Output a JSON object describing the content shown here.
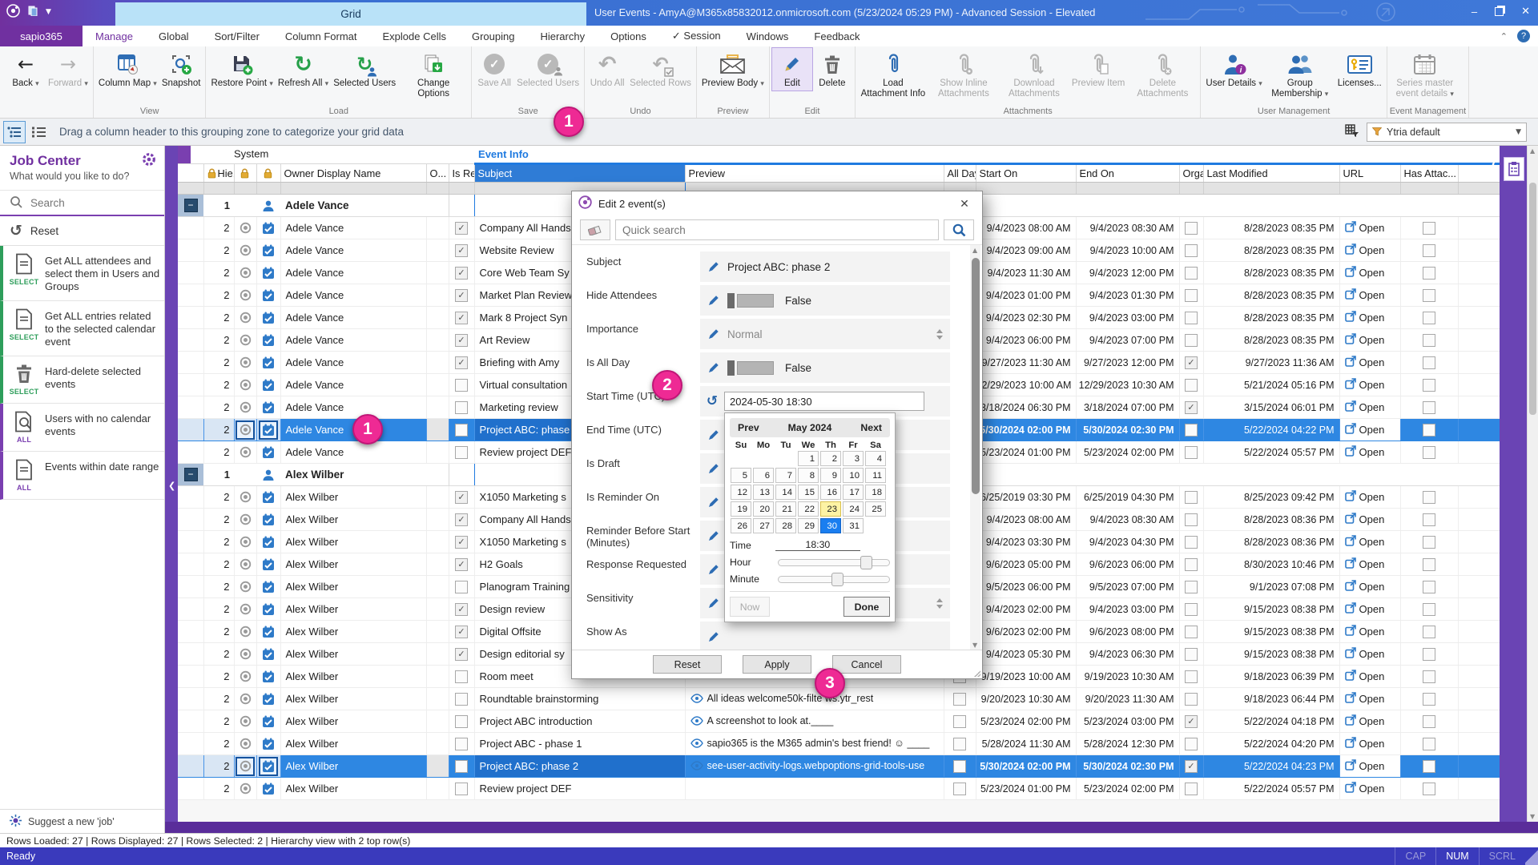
{
  "titlebar": {
    "tab": "Grid",
    "title": "User Events - AmyA@M365x85832012.onmicrosoft.com (5/23/2024 05:29 PM) - Advanced Session - Elevated"
  },
  "tabs": {
    "app": "sapio365",
    "active": "Manage",
    "items": [
      "Manage",
      "Global",
      "Sort/Filter",
      "Column Format",
      "Explode Cells",
      "Grouping",
      "Hierarchy",
      "Options",
      "✓ Session",
      "Windows",
      "Feedback"
    ]
  },
  "ribbon": {
    "groups": [
      {
        "label": "",
        "items": [
          {
            "icon": "arrow-left",
            "label": "Back",
            "enabled": true,
            "drop": true
          },
          {
            "icon": "arrow-right",
            "label": "Forward",
            "enabled": false,
            "drop": true
          }
        ]
      },
      {
        "label": "View",
        "items": [
          {
            "icon": "column-map",
            "label": "Column Map",
            "enabled": true,
            "drop": true
          },
          {
            "icon": "snapshot",
            "label": "Snapshot",
            "enabled": true
          }
        ]
      },
      {
        "label": "Load",
        "items": [
          {
            "icon": "restore-point",
            "label": "Restore Point",
            "enabled": true,
            "drop": true
          },
          {
            "icon": "refresh",
            "label": "Refresh All",
            "enabled": true,
            "drop": true
          },
          {
            "icon": "refresh-users",
            "label": "Selected Users",
            "enabled": true
          },
          {
            "icon": "change-options",
            "label": "Change Options",
            "enabled": true
          }
        ]
      },
      {
        "label": "Save",
        "items": [
          {
            "icon": "save-all",
            "label": "Save All",
            "enabled": false
          },
          {
            "icon": "save-users",
            "label": "Selected Users",
            "enabled": false
          }
        ]
      },
      {
        "label": "Undo",
        "items": [
          {
            "icon": "undo",
            "label": "Undo All",
            "enabled": false
          },
          {
            "icon": "undo-rows",
            "label": "Selected Rows",
            "enabled": false
          }
        ]
      },
      {
        "label": "Preview",
        "items": [
          {
            "icon": "envelope",
            "label": "Preview Body",
            "enabled": true,
            "drop": true
          }
        ]
      },
      {
        "label": "Edit",
        "items": [
          {
            "icon": "pencil",
            "label": "Edit",
            "enabled": true,
            "highlight": true
          },
          {
            "icon": "trash",
            "label": "Delete",
            "enabled": true
          }
        ]
      },
      {
        "label": "Attachments",
        "items": [
          {
            "icon": "clip-blue",
            "label": "Load Attachment Info",
            "enabled": true
          },
          {
            "icon": "clip-eye",
            "label": "Show Inline Attachments",
            "enabled": false
          },
          {
            "icon": "clip-down",
            "label": "Download Attachments",
            "enabled": false
          },
          {
            "icon": "clip-doc",
            "label": "Preview Item",
            "enabled": false
          },
          {
            "icon": "clip-x",
            "label": "Delete Attachments",
            "enabled": false
          }
        ]
      },
      {
        "label": "User Management",
        "items": [
          {
            "icon": "user-info",
            "label": "User Details",
            "enabled": true,
            "drop": true
          },
          {
            "icon": "users",
            "label": "Group Membership",
            "enabled": true,
            "drop": true
          },
          {
            "icon": "license",
            "label": "Licenses...",
            "enabled": true
          }
        ]
      },
      {
        "label": "Event Management",
        "items": [
          {
            "icon": "calendar-gray",
            "label": "Series master event details",
            "enabled": false,
            "drop": true
          }
        ]
      }
    ]
  },
  "groupbar": {
    "hint": "Drag a column header to this grouping zone to categorize your grid data",
    "preset": "Ytria default"
  },
  "sidebar": {
    "title": "Job Center",
    "subtitle": "What would you like to do?",
    "search_placeholder": "Search",
    "reset": "Reset",
    "items": [
      {
        "badge": "SELECT",
        "accent": "#2e9e5b",
        "icon": "doc",
        "label": "Get ALL attendees and select them in Users and Groups"
      },
      {
        "badge": "SELECT",
        "accent": "#2e9e5b",
        "icon": "doc",
        "label": "Get ALL entries related to the selected calendar event"
      },
      {
        "badge": "SELECT",
        "accent": "#2e9e5b",
        "icon": "trash",
        "label": "Hard-delete selected events"
      },
      {
        "badge": "ALL",
        "accent": "#7a3fb0",
        "icon": "doc-search",
        "label": "Users with no calendar events"
      },
      {
        "badge": "ALL",
        "accent": "#7a3fb0",
        "icon": "doc",
        "label": "Events within date range"
      }
    ],
    "footer": "Suggest a new 'job'"
  },
  "grid": {
    "bands": [
      "System",
      "Event Info"
    ],
    "open_label": "Open",
    "columns": [
      {
        "key": "hie",
        "label": "Hie...",
        "lock": true
      },
      {
        "key": "icon1",
        "label": "",
        "lock": true
      },
      {
        "key": "icon2",
        "label": "",
        "lock": true
      },
      {
        "key": "owner",
        "label": "Owner Display Name"
      },
      {
        "key": "o",
        "label": "O..."
      },
      {
        "key": "isrec",
        "label": "Is Rec..."
      },
      {
        "key": "subject",
        "label": "Subject",
        "selected": true
      },
      {
        "key": "preview",
        "label": "Preview"
      },
      {
        "key": "allday",
        "label": "All Day"
      },
      {
        "key": "start",
        "label": "Start On"
      },
      {
        "key": "end",
        "label": "End On"
      },
      {
        "key": "organizer",
        "label": "Organi..."
      },
      {
        "key": "modified",
        "label": "Last Modified"
      },
      {
        "key": "url",
        "label": "URL"
      },
      {
        "key": "attach",
        "label": "Has Attac..."
      }
    ],
    "groups": [
      {
        "count": "1",
        "name": "Adele Vance",
        "rows": [
          {
            "hie": "2",
            "isrec": true,
            "subject": "Company All Hands",
            "start": "9/4/2023 08:00 AM",
            "end": "9/4/2023 08:30 AM",
            "org": false,
            "mod": "8/28/2023 08:35 PM"
          },
          {
            "hie": "2",
            "isrec": true,
            "subject": "Website Review",
            "start": "9/4/2023 09:00 AM",
            "end": "9/4/2023 10:00 AM",
            "org": false,
            "mod": "8/28/2023 08:35 PM"
          },
          {
            "hie": "2",
            "isrec": true,
            "subject": "Core Web Team Sy",
            "start": "9/4/2023 11:30 AM",
            "end": "9/4/2023 12:00 PM",
            "org": false,
            "mod": "8/28/2023 08:35 PM"
          },
          {
            "hie": "2",
            "isrec": true,
            "subject": "Market Plan Review",
            "start": "9/4/2023 01:00 PM",
            "end": "9/4/2023 01:30 PM",
            "org": false,
            "mod": "8/28/2023 08:35 PM"
          },
          {
            "hie": "2",
            "isrec": true,
            "subject": "Mark 8 Project Syn",
            "start": "9/4/2023 02:30 PM",
            "end": "9/4/2023 03:00 PM",
            "org": false,
            "mod": "8/28/2023 08:35 PM"
          },
          {
            "hie": "2",
            "isrec": true,
            "subject": "Art Review",
            "start": "9/4/2023 06:00 PM",
            "end": "9/4/2023 07:00 PM",
            "org": false,
            "mod": "8/28/2023 08:35 PM"
          },
          {
            "hie": "2",
            "isrec": true,
            "subject": "Briefing with Amy",
            "start": "9/27/2023 11:30 AM",
            "end": "9/27/2023 12:00 PM",
            "org": true,
            "mod": "9/27/2023 11:36 AM"
          },
          {
            "hie": "2",
            "isrec": false,
            "subject": "Virtual consultation",
            "start": "12/29/2023 10:00 AM",
            "end": "12/29/2023 10:30 AM",
            "org": false,
            "mod": "5/21/2024 05:16 PM"
          },
          {
            "hie": "2",
            "isrec": false,
            "subject": "Marketing review",
            "start": "3/18/2024 06:30 PM",
            "end": "3/18/2024 07:00 PM",
            "org": true,
            "mod": "3/15/2024 06:01 PM"
          },
          {
            "hie": "2",
            "isrec": false,
            "subject": "Project ABC: phase",
            "selected": true,
            "start": "5/30/2024 02:00 PM",
            "end": "5/30/2024 02:30 PM",
            "org": false,
            "mod": "5/22/2024 04:22 PM"
          },
          {
            "hie": "2",
            "isrec": false,
            "subject": "Review project DEF",
            "start": "5/23/2024 01:00 PM",
            "end": "5/23/2024 02:00 PM",
            "org": false,
            "mod": "5/22/2024 05:57 PM"
          }
        ]
      },
      {
        "count": "1",
        "name": "Alex Wilber",
        "rows": [
          {
            "hie": "2",
            "isrec": true,
            "subject": "X1050 Marketing s",
            "start": "6/25/2019 03:30 PM",
            "end": "6/25/2019 04:30 PM",
            "org": false,
            "mod": "8/25/2023 09:42 PM"
          },
          {
            "hie": "2",
            "isrec": true,
            "subject": "Company All Hands",
            "start": "9/4/2023 08:00 AM",
            "end": "9/4/2023 08:30 AM",
            "org": false,
            "mod": "8/28/2023 08:36 PM"
          },
          {
            "hie": "2",
            "isrec": true,
            "subject": "X1050 Marketing s",
            "start": "9/4/2023 03:30 PM",
            "end": "9/4/2023 04:30 PM",
            "org": false,
            "mod": "8/28/2023 08:36 PM"
          },
          {
            "hie": "2",
            "isrec": true,
            "subject": "H2 Goals",
            "start": "9/6/2023 05:00 PM",
            "end": "9/6/2023 06:00 PM",
            "org": false,
            "mod": "8/30/2023 10:46 PM"
          },
          {
            "hie": "2",
            "isrec": false,
            "subject": "Planogram Training",
            "start": "9/5/2023 06:00 PM",
            "end": "9/5/2023 07:00 PM",
            "org": false,
            "mod": "9/1/2023 07:08 PM"
          },
          {
            "hie": "2",
            "isrec": true,
            "subject": "Design review",
            "start": "9/4/2023 02:00 PM",
            "end": "9/4/2023 03:00 PM",
            "org": false,
            "mod": "9/15/2023 08:38 PM"
          },
          {
            "hie": "2",
            "isrec": true,
            "subject": "Digital Offsite",
            "start": "9/6/2023 02:00 PM",
            "end": "9/6/2023 08:00 PM",
            "org": false,
            "mod": "9/15/2023 08:38 PM"
          },
          {
            "hie": "2",
            "isrec": true,
            "subject": "Design editorial sy",
            "start": "9/4/2023 05:30 PM",
            "end": "9/4/2023 06:30 PM",
            "org": false,
            "mod": "9/15/2023 08:38 PM"
          },
          {
            "hie": "2",
            "isrec": false,
            "subject": "Room meet",
            "start": "9/19/2023 10:00 AM",
            "end": "9/19/2023 10:30 AM",
            "org": false,
            "mod": "9/18/2023 06:39 PM"
          },
          {
            "hie": "2",
            "isrec": false,
            "subject": "Roundtable brainstorming",
            "preview": "All ideas welcome50k-filte ws.ytr_rest",
            "start": "9/20/2023 10:30 AM",
            "end": "9/20/2023 11:30 AM",
            "org": false,
            "mod": "9/18/2023 06:44 PM"
          },
          {
            "hie": "2",
            "isrec": false,
            "subject": "Project ABC introduction",
            "preview": "A screenshot to look at.____",
            "start": "5/23/2024 02:00 PM",
            "end": "5/23/2024 03:00 PM",
            "org": true,
            "mod": "5/22/2024 04:18 PM"
          },
          {
            "hie": "2",
            "isrec": false,
            "subject": "Project ABC - phase 1",
            "preview": "sapio365 is the M365 admin's best friend! ☺ ____",
            "start": "5/28/2024 11:30 AM",
            "end": "5/28/2024 12:30 PM",
            "org": false,
            "mod": "5/22/2024 04:20 PM"
          },
          {
            "hie": "2",
            "isrec": false,
            "subject": "Project ABC: phase 2",
            "selected": true,
            "preview": "see-user-activity-logs.webpoptions-grid-tools-use",
            "start": "5/30/2024 02:00 PM",
            "end": "5/30/2024 02:30 PM",
            "org": true,
            "mod": "5/22/2024 04:23 PM"
          },
          {
            "hie": "2",
            "isrec": false,
            "subject": "Review project DEF",
            "start": "5/23/2024 01:00 PM",
            "end": "5/23/2024 02:00 PM",
            "org": false,
            "mod": "5/22/2024 05:57 PM"
          }
        ]
      }
    ]
  },
  "dialog": {
    "title": "Edit 2 event(s)",
    "search_placeholder": "Quick search",
    "fields": [
      {
        "label": "Subject",
        "type": "text",
        "value": "Project ABC: phase 2"
      },
      {
        "label": "Hide Attendees",
        "type": "toggle",
        "value": "False"
      },
      {
        "label": "Importance",
        "type": "spin",
        "value": "Normal"
      },
      {
        "label": "Is All Day",
        "type": "toggle",
        "value": "False"
      },
      {
        "label": "Start Time (UTC)",
        "type": "datetime",
        "value": "2024-05-30 18:30"
      },
      {
        "label": "End Time (UTC)",
        "type": "plain"
      },
      {
        "label": "Is Draft",
        "type": "plain"
      },
      {
        "label": "Is Reminder On",
        "type": "plain"
      },
      {
        "label": "Reminder Before Start (Minutes)",
        "type": "plain"
      },
      {
        "label": "Response Requested",
        "type": "plain"
      },
      {
        "label": "Sensitivity",
        "type": "spin2"
      },
      {
        "label": "Show As",
        "type": "plain"
      }
    ],
    "buttons": [
      "Reset",
      "Apply",
      "Cancel"
    ],
    "calendar": {
      "prev": "Prev",
      "title": "May 2024",
      "next": "Next",
      "days": [
        "Su",
        "Mo",
        "Tu",
        "We",
        "Th",
        "Fr",
        "Sa"
      ],
      "weeks": [
        [
          "",
          "",
          "",
          "1",
          "2",
          "3",
          "4"
        ],
        [
          "5",
          "6",
          "7",
          "8",
          "9",
          "10",
          "11"
        ],
        [
          "12",
          "13",
          "14",
          "15",
          "16",
          "17",
          "18"
        ],
        [
          "19",
          "20",
          "21",
          "22",
          "23",
          "24",
          "25"
        ],
        [
          "26",
          "27",
          "28",
          "29",
          "30",
          "31",
          ""
        ]
      ],
      "today": "23",
      "selected": "30",
      "time_label": "Time",
      "time": "18:30",
      "hour_label": "Hour",
      "minute_label": "Minute",
      "now": "Now",
      "done": "Done",
      "hour_pct": 74,
      "minute_pct": 48
    }
  },
  "status": {
    "info": "Rows Loaded: 27 | Rows Displayed: 27 | Rows Selected: 2 | Hierarchy view with 2 top row(s)",
    "ready": "Ready",
    "flags": [
      {
        "label": "CAP",
        "active": false
      },
      {
        "label": "NUM",
        "active": true
      },
      {
        "label": "SCRL",
        "active": false
      }
    ]
  },
  "callouts": [
    {
      "n": "1"
    },
    {
      "n": "1"
    },
    {
      "n": "2"
    },
    {
      "n": "3"
    }
  ]
}
